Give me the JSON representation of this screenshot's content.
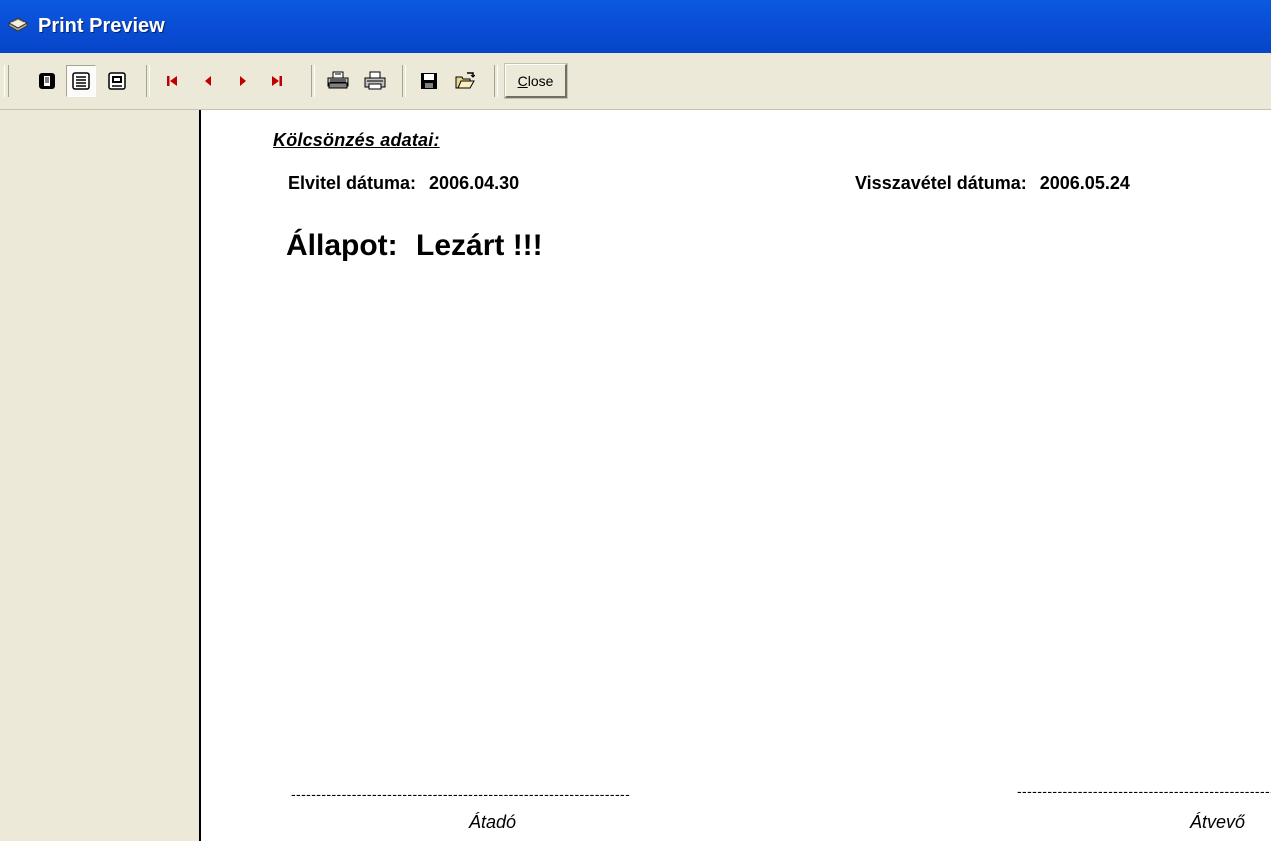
{
  "window": {
    "title": "Print Preview"
  },
  "toolbar": {
    "close_label_mnemonic": "C",
    "close_label_rest": "lose",
    "buttons": [
      {
        "icon": "single-page-icon",
        "pressed": false
      },
      {
        "icon": "multi-page-icon",
        "pressed": true
      },
      {
        "icon": "zoom-page-icon",
        "pressed": false
      },
      {
        "icon": "first-page-icon"
      },
      {
        "icon": "previous-page-icon"
      },
      {
        "icon": "next-page-icon"
      },
      {
        "icon": "last-page-icon"
      },
      {
        "icon": "print-setup-icon"
      },
      {
        "icon": "print-icon"
      },
      {
        "icon": "save-icon"
      },
      {
        "icon": "open-icon"
      }
    ]
  },
  "report": {
    "section_heading": "Kölcsönzés adatai:",
    "pickup_date_label": "Elvitel dátuma:",
    "pickup_date_value": "2006.04.30",
    "return_date_label": "Visszavétel dátuma:",
    "return_date_value": "2006.05.24",
    "status_label": "Állapot:",
    "status_value": "Lezárt !!!",
    "signature_left_line": "-------------------------------------------------------------------",
    "signature_left_label": "Átadó",
    "signature_right_line": "-------------------------------------------------------------------",
    "signature_right_label": "Átvevő"
  },
  "colors": {
    "titlebar": "#0a4fd8",
    "toolbar_bg": "#ece9d8",
    "nav_arrows": "#c00000",
    "page_bg": "#ffffff"
  }
}
